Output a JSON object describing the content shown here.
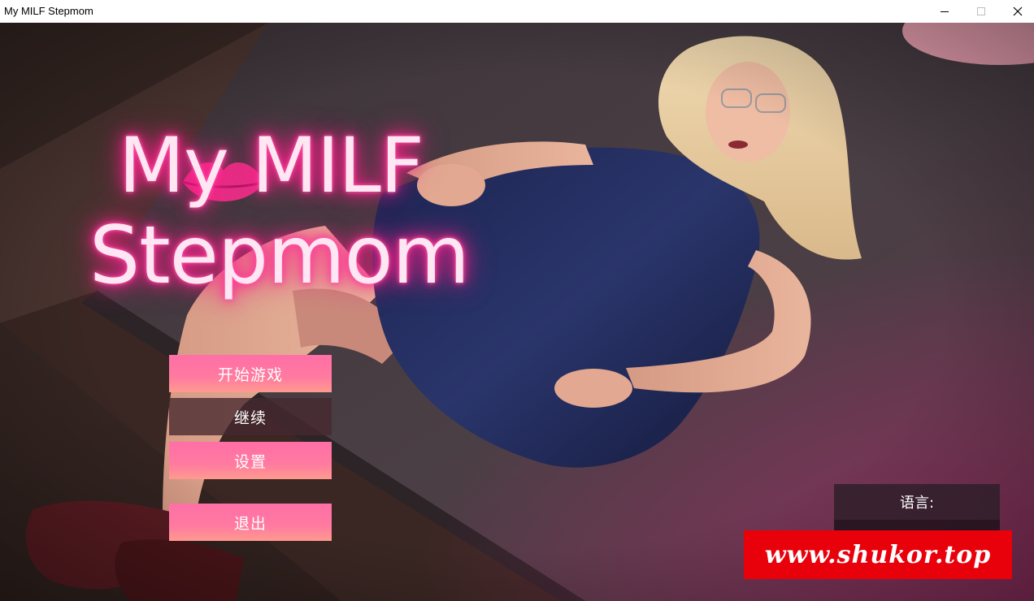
{
  "window": {
    "title": "My MILF Stepmom",
    "controls": [
      "minimize-icon",
      "maximize-icon",
      "close-icon"
    ]
  },
  "game": {
    "logo": {
      "line1": "My MILF",
      "line2": "Stepmom"
    },
    "menu": {
      "start": "开始游戏",
      "continue": "继续",
      "settings": "设置",
      "quit": "退出"
    },
    "language": {
      "label": "语言:"
    },
    "watermark": "www.shukor.top"
  },
  "colors": {
    "button_pink": "#ff6fa6",
    "button_dark": "#462830",
    "neon_pink": "#ff1f8a",
    "watermark_red": "#e8000b"
  }
}
